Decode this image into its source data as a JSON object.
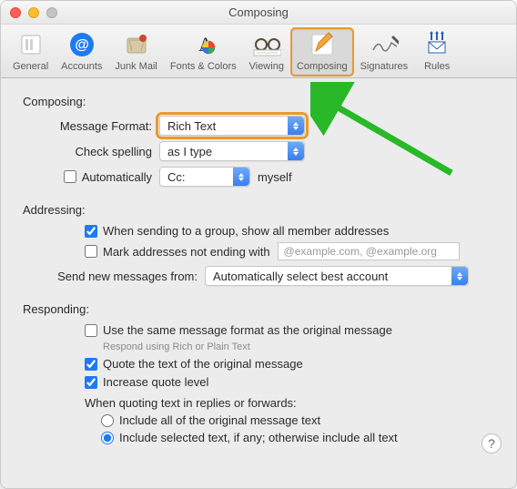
{
  "window": {
    "title": "Composing"
  },
  "toolbar": {
    "items": [
      {
        "label": "General"
      },
      {
        "label": "Accounts"
      },
      {
        "label": "Junk Mail"
      },
      {
        "label": "Fonts & Colors"
      },
      {
        "label": "Viewing"
      },
      {
        "label": "Composing"
      },
      {
        "label": "Signatures"
      },
      {
        "label": "Rules"
      }
    ],
    "selected_index": 5
  },
  "composing_section": {
    "heading": "Composing:",
    "message_format": {
      "label": "Message Format:",
      "value": "Rich Text"
    },
    "check_spelling": {
      "label": "Check spelling",
      "value": "as I type"
    },
    "auto_cc": {
      "checkbox_label": "Automatically",
      "checked": false,
      "select_value": "Cc:",
      "trailing": "myself"
    }
  },
  "addressing_section": {
    "heading": "Addressing:",
    "group_addresses": {
      "label": "When sending to a group, show all member addresses",
      "checked": true
    },
    "mark_not_ending": {
      "label": "Mark addresses not ending with",
      "checked": false,
      "placeholder": "@example.com, @example.org"
    },
    "send_from": {
      "label": "Send new messages from:",
      "value": "Automatically select best account"
    }
  },
  "responding_section": {
    "heading": "Responding:",
    "same_format": {
      "label": "Use the same message format as the original message",
      "sublabel": "Respond using Rich or Plain Text",
      "checked": false
    },
    "quote_text": {
      "label": "Quote the text of the original message",
      "checked": true
    },
    "increase_quote": {
      "label": "Increase quote level",
      "checked": true
    },
    "quoting_heading": "When quoting text in replies or forwards:",
    "radio_all": {
      "label": "Include all of the original message text",
      "selected": false
    },
    "radio_selected": {
      "label": "Include selected text, if any; otherwise include all text",
      "selected": true
    }
  },
  "help_button": "?",
  "annotations": {
    "highlight_toolbar_item": 5,
    "highlight_message_format_select": true,
    "arrow_points_to": "message_format_select"
  }
}
